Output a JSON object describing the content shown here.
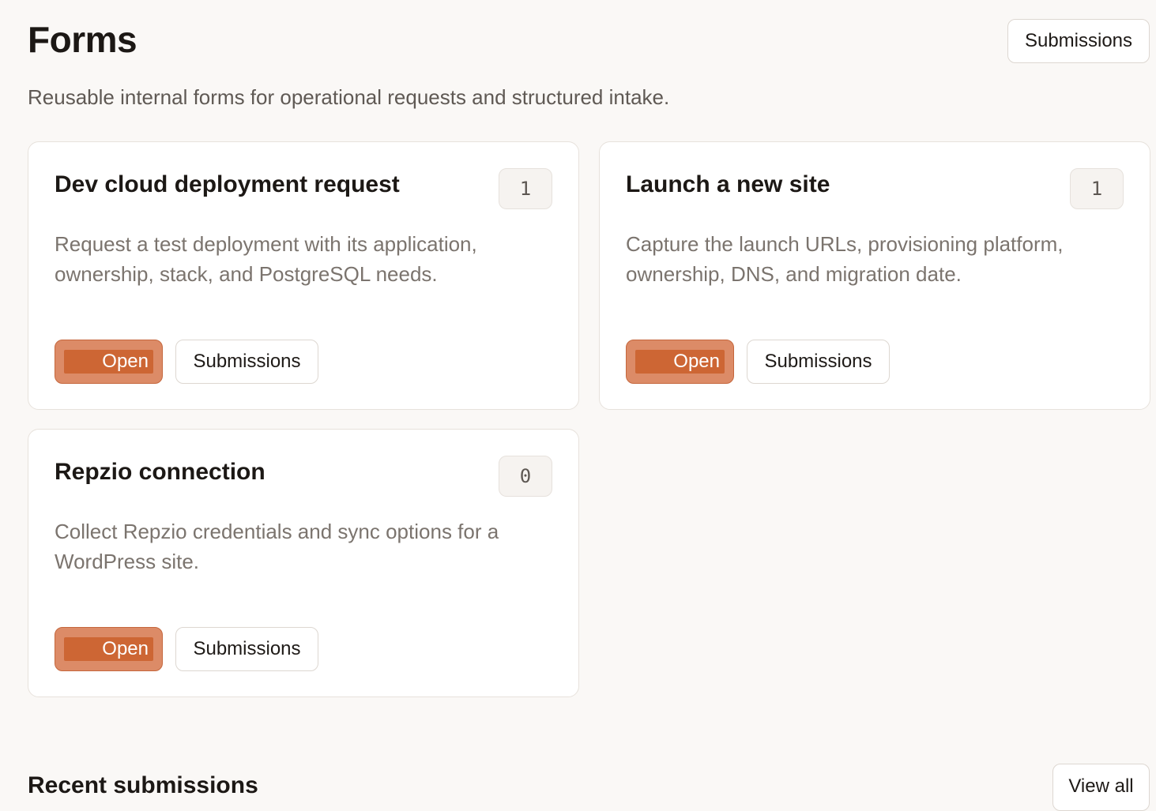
{
  "header": {
    "title": "Forms",
    "submissions_label": "Submissions",
    "subtitle": "Reusable internal forms for operational requests and structured intake."
  },
  "forms": [
    {
      "title": "Dev cloud deployment request",
      "count": "1",
      "description": "Request a test deployment with its application, ownership, stack, and PostgreSQL needs.",
      "open_label": "Open",
      "submissions_label": "Submissions"
    },
    {
      "title": "Launch a new site",
      "count": "1",
      "description": "Capture the launch URLs, provisioning platform, ownership, DNS, and migration date.",
      "open_label": "Open",
      "submissions_label": "Submissions"
    },
    {
      "title": "Repzio connection",
      "count": "0",
      "description": "Collect Repzio credentials and sync options for a WordPress site.",
      "open_label": "Open",
      "submissions_label": "Submissions"
    }
  ],
  "recent": {
    "title": "Recent submissions",
    "view_all_label": "View all"
  },
  "colors": {
    "background": "#faf8f6",
    "card_background": "#ffffff",
    "accent": "#cd6634",
    "accent_outer": "#dc8b67",
    "text_primary": "#1c1815",
    "text_muted": "#7b746e"
  }
}
